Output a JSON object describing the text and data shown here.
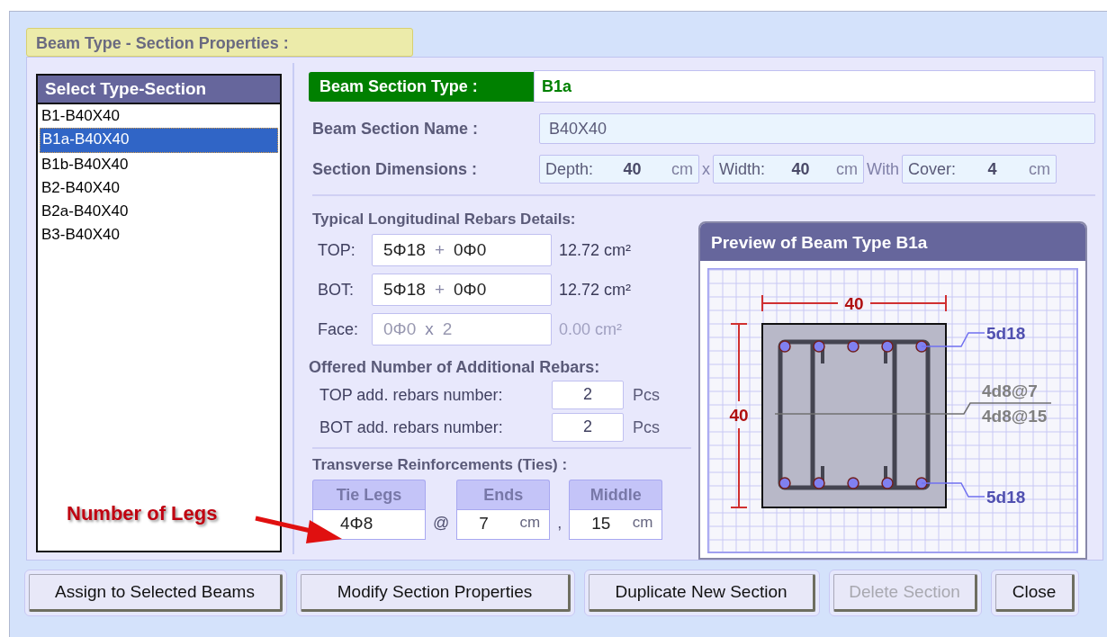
{
  "tab": {
    "label": "Beam Type - Section Properties :",
    "selected": true
  },
  "section_list": {
    "header": "Select  Type-Section",
    "items": [
      {
        "label": "B1-B40X40",
        "selected": false
      },
      {
        "label": "B1a-B40X40",
        "selected": true
      },
      {
        "label": "B1b-B40X40",
        "selected": false
      },
      {
        "label": "B2-B40X40",
        "selected": false
      },
      {
        "label": "B2a-B40X40",
        "selected": false
      },
      {
        "label": "B3-B40X40",
        "selected": false
      }
    ]
  },
  "section_type": {
    "label": "Beam Section Type :",
    "value": "B1a"
  },
  "section_name": {
    "label": "Beam Section Name :",
    "value": "B40X40"
  },
  "dimensions": {
    "label": "Section Dimensions :",
    "times": "x",
    "with": "With",
    "fields": [
      {
        "label": "Depth:",
        "value": "40",
        "unit": "cm"
      },
      {
        "label": "Width:",
        "value": "40",
        "unit": "cm"
      },
      {
        "label": "Cover:",
        "value": "4",
        "unit": "cm"
      }
    ]
  },
  "longitudinal": {
    "title": "Typical Longitudinal Rebars Details:",
    "rows": [
      {
        "label": "TOP:",
        "main": "5Φ18",
        "joiner": "+",
        "extra": "0Φ0",
        "area": "12.72 cm²",
        "disabled": false
      },
      {
        "label": "BOT:",
        "main": "5Φ18",
        "joiner": "+",
        "extra": "0Φ0",
        "area": "12.72 cm²",
        "disabled": false
      },
      {
        "label": "Face:",
        "main": "0Φ0",
        "joiner": "x",
        "extra": "2",
        "area": "0.00 cm²",
        "disabled": true
      }
    ]
  },
  "additional": {
    "title": "Offered Number of Additional Rebars:",
    "rows": [
      {
        "label": "TOP add. rebars number:",
        "value": "2",
        "unit": "Pcs"
      },
      {
        "label": "BOT add. rebars number:",
        "value": "2",
        "unit": "Pcs"
      }
    ]
  },
  "ties": {
    "title": "Transverse Reinforcements (Ties) :",
    "legs": {
      "header": "Tie Legs",
      "value": "4Φ8"
    },
    "at": "@",
    "ends": {
      "header": "Ends",
      "value": "7",
      "unit": "cm"
    },
    "comma": ",",
    "middle": {
      "header": "Middle",
      "value": "15",
      "unit": "cm"
    }
  },
  "preview": {
    "title": "Preview of Beam Type B1a",
    "width_dim": "40",
    "depth_dim": "40",
    "top_label": "5d18",
    "ties_ends_label": "4d8@7",
    "ties_middle_label": "4d8@15",
    "bottom_label": "5d18"
  },
  "annotation": {
    "text": "Number of Legs"
  },
  "buttons": [
    {
      "label": "Assign to Selected Beams",
      "disabled": false
    },
    {
      "label": "Modify Section Properties",
      "disabled": false
    },
    {
      "label": "Duplicate New Section",
      "disabled": false
    },
    {
      "label": "Delete Section",
      "disabled": true
    },
    {
      "label": "Close",
      "disabled": false
    }
  ]
}
